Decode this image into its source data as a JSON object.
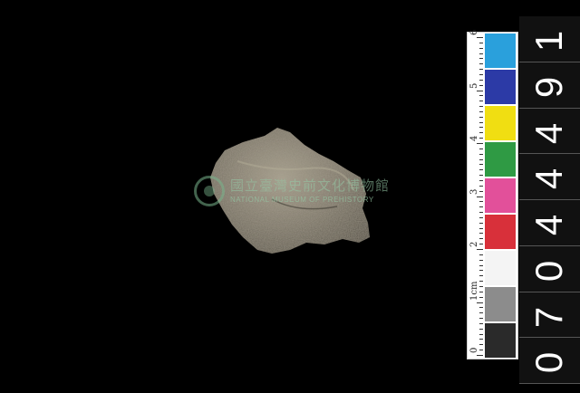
{
  "watermark": {
    "zh": "國立臺灣史前文化博物館",
    "en": "NATIONAL MUSEUM OF PREHISTORY"
  },
  "scale_bar": {
    "numbers": [
      "0",
      "1cm",
      "2",
      "3",
      "4",
      "5",
      "6"
    ],
    "swatches": [
      {
        "color": "#2a2a2a"
      },
      {
        "color": "#8c8c8c"
      },
      {
        "color": "#f4f4f4"
      },
      {
        "color": "#d8303a"
      },
      {
        "color": "#e2509a"
      },
      {
        "color": "#2f9a44"
      },
      {
        "color": "#f0de12"
      },
      {
        "color": "#2c3aa6"
      },
      {
        "color": "#2aa0dc"
      }
    ]
  },
  "catalog_number": [
    "0",
    "7",
    "0",
    "4",
    "4",
    "4",
    "9",
    "1"
  ],
  "colors": {
    "background": "#000000",
    "stone_base": "#7a7466",
    "stone_highlight": "#a59e8c",
    "stone_shadow": "#4e4a40"
  }
}
